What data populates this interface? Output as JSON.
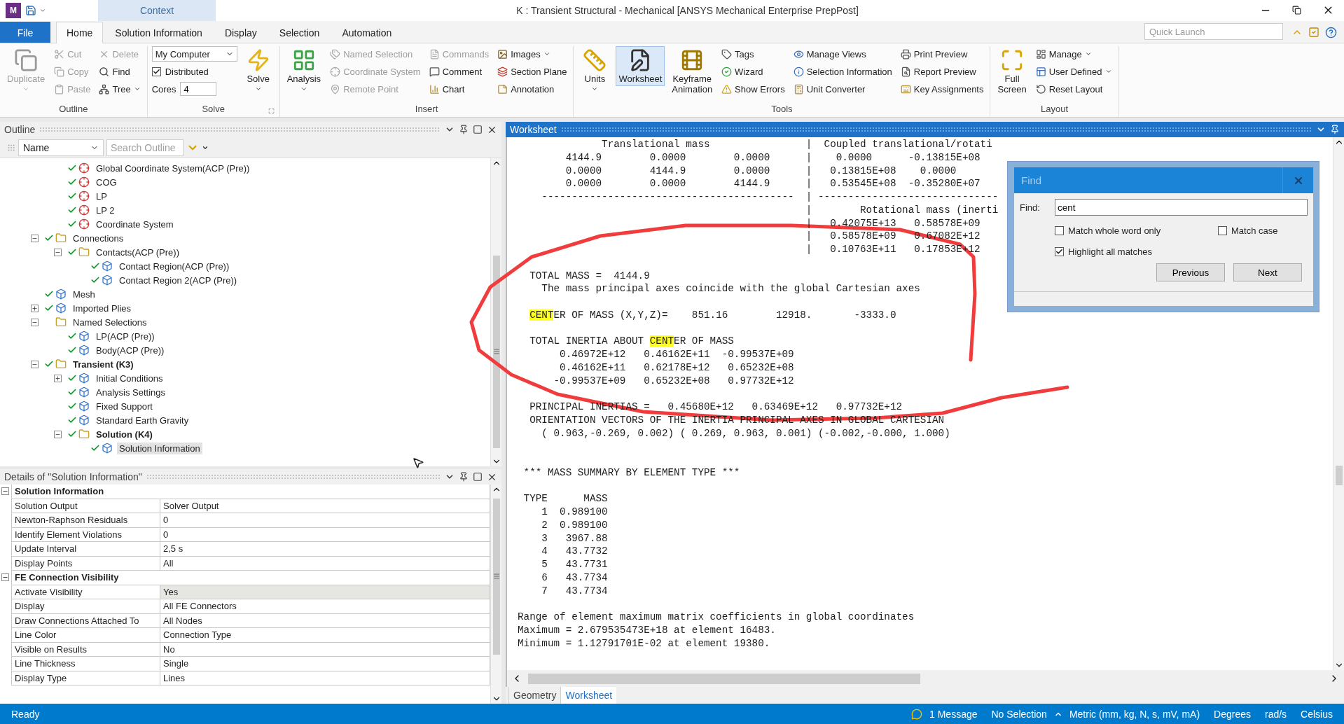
{
  "title_bar": {
    "app_badge": "M",
    "context_tab": "Context",
    "title": "K : Transient Structural - Mechanical [ANSYS Mechanical Enterprise PrepPost]"
  },
  "ribbon_tabs": [
    {
      "label": "File",
      "kind": "file",
      "selected": false
    },
    {
      "label": "Home",
      "kind": "tab",
      "selected": true
    },
    {
      "label": "Solution Information",
      "kind": "tab",
      "selected": false
    },
    {
      "label": "Display",
      "kind": "tab",
      "selected": false
    },
    {
      "label": "Selection",
      "kind": "tab",
      "selected": false
    },
    {
      "label": "Automation",
      "kind": "tab",
      "selected": false
    }
  ],
  "quick_launch": {
    "placeholder": "Quick Launch"
  },
  "ribbon_groups": [
    {
      "label": "Outline",
      "launcher": false,
      "columns": [
        [
          {
            "kind": "large",
            "label": "Duplicate",
            "disabled": true,
            "active": false,
            "menu": true
          }
        ],
        [
          {
            "kind": "small",
            "label": "Cut",
            "disabled": true,
            "menu": false
          },
          {
            "kind": "small",
            "label": "Copy",
            "disabled": true,
            "menu": false
          },
          {
            "kind": "small",
            "label": "Paste",
            "disabled": true,
            "menu": false
          }
        ],
        [
          {
            "kind": "small",
            "label": "Delete",
            "disabled": true,
            "menu": false
          },
          {
            "kind": "small",
            "label": "Find",
            "disabled": false,
            "menu": false
          },
          {
            "kind": "small",
            "label": "Tree",
            "disabled": false,
            "menu": true
          }
        ]
      ]
    },
    {
      "label": "Solve",
      "launcher": true,
      "columns": [
        [
          {
            "kind": "select",
            "value": "My Computer"
          },
          {
            "kind": "check",
            "label": "Distributed",
            "checked": true
          },
          {
            "kind": "field",
            "label": "Cores",
            "value": "4"
          }
        ],
        [
          {
            "kind": "large",
            "label": "Solve",
            "disabled": false,
            "active": false,
            "menu": true
          }
        ]
      ]
    },
    {
      "label": "Insert",
      "launcher": false,
      "columns": [
        [
          {
            "kind": "large",
            "label": "Analysis",
            "disabled": false,
            "active": false,
            "menu": true
          }
        ],
        [
          {
            "kind": "small",
            "label": "Named Selection",
            "disabled": true,
            "menu": false
          },
          {
            "kind": "small",
            "label": "Coordinate System",
            "disabled": true,
            "menu": false
          },
          {
            "kind": "small",
            "label": "Remote Point",
            "disabled": true,
            "menu": false
          }
        ],
        [
          {
            "kind": "small",
            "label": "Commands",
            "disabled": true,
            "menu": false
          },
          {
            "kind": "small",
            "label": "Comment",
            "disabled": false,
            "menu": false
          },
          {
            "kind": "small",
            "label": "Chart",
            "disabled": false,
            "menu": false
          }
        ],
        [
          {
            "kind": "small",
            "label": "Images",
            "disabled": false,
            "menu": true
          },
          {
            "kind": "small",
            "label": "Section Plane",
            "disabled": false,
            "menu": false
          },
          {
            "kind": "small",
            "label": "Annotation",
            "disabled": false,
            "menu": false
          }
        ]
      ]
    },
    {
      "label": "Tools",
      "launcher": false,
      "columns": [
        [
          {
            "kind": "large",
            "label": "Units",
            "disabled": false,
            "active": false,
            "menu": true
          }
        ],
        [
          {
            "kind": "large",
            "label": "Worksheet",
            "disabled": false,
            "active": true,
            "menu": false
          }
        ],
        [
          {
            "kind": "large",
            "label": "Keyframe Animation",
            "disabled": false,
            "active": false,
            "menu": false
          }
        ],
        [
          {
            "kind": "small",
            "label": "Tags",
            "disabled": false,
            "menu": false
          },
          {
            "kind": "small",
            "label": "Wizard",
            "disabled": false,
            "menu": false
          },
          {
            "kind": "small",
            "label": "Show Errors",
            "disabled": false,
            "menu": false
          }
        ],
        [
          {
            "kind": "small",
            "label": "Manage Views",
            "disabled": false,
            "menu": false
          },
          {
            "kind": "small",
            "label": "Selection Information",
            "disabled": false,
            "menu": false
          },
          {
            "kind": "small",
            "label": "Unit Converter",
            "disabled": false,
            "menu": false
          }
        ],
        [
          {
            "kind": "small",
            "label": "Print Preview",
            "disabled": false,
            "menu": false
          },
          {
            "kind": "small",
            "label": "Report Preview",
            "disabled": false,
            "menu": false
          },
          {
            "kind": "small",
            "label": "Key Assignments",
            "disabled": false,
            "menu": false
          }
        ]
      ]
    },
    {
      "label": "Layout",
      "launcher": false,
      "columns": [
        [
          {
            "kind": "large",
            "label": "Full Screen",
            "disabled": false,
            "active": false,
            "menu": false
          }
        ],
        [
          {
            "kind": "small",
            "label": "Manage",
            "disabled": false,
            "menu": true
          },
          {
            "kind": "small",
            "label": "User Defined",
            "disabled": false,
            "menu": true
          },
          {
            "kind": "small",
            "label": "Reset Layout",
            "disabled": false,
            "menu": false
          }
        ]
      ]
    }
  ],
  "outline": {
    "title": "Outline",
    "filter": "Name",
    "search": {
      "placeholder": "Search Outline"
    },
    "tree": {
      "continued": [
        {
          "label": "Global Coordinate System(ACP (Pre))",
          "checked": true,
          "bold": false,
          "selected": false
        },
        {
          "label": "COG",
          "checked": true,
          "bold": false,
          "selected": false
        },
        {
          "label": "LP",
          "checked": true,
          "bold": false,
          "selected": false
        },
        {
          "label": "LP 2",
          "checked": true,
          "bold": false,
          "selected": false
        },
        {
          "label": "Coordinate System",
          "checked": true,
          "bold": false,
          "selected": false
        }
      ],
      "nodes": [
        {
          "label": "Connections",
          "checked": true,
          "bold": false,
          "selected": false,
          "expanded": true,
          "children": [
            {
              "label": "Contacts(ACP (Pre))",
              "checked": true,
              "bold": false,
              "selected": false,
              "expanded": true,
              "children": [
                {
                  "label": "Contact Region(ACP (Pre))",
                  "checked": true,
                  "bold": false,
                  "selected": false
                },
                {
                  "label": "Contact Region 2(ACP (Pre))",
                  "checked": true,
                  "bold": false,
                  "selected": false
                }
              ]
            }
          ]
        },
        {
          "label": "Mesh",
          "checked": true,
          "bold": false,
          "selected": false
        },
        {
          "label": "Imported Plies",
          "checked": true,
          "bold": false,
          "selected": false,
          "expanded": false
        },
        {
          "label": "Named Selections",
          "checked": false,
          "bold": false,
          "selected": false,
          "expanded": true,
          "children": [
            {
              "label": "LP(ACP (Pre))",
              "checked": true,
              "bold": false,
              "selected": false
            },
            {
              "label": "Body(ACP (Pre))",
              "checked": true,
              "bold": false,
              "selected": false
            }
          ]
        },
        {
          "label": "Transient (K3)",
          "checked": true,
          "bold": true,
          "selected": false,
          "expanded": true,
          "children": [
            {
              "label": "Initial Conditions",
              "checked": true,
              "bold": false,
              "selected": false,
              "expanded": false
            },
            {
              "label": "Analysis Settings",
              "checked": true,
              "bold": false,
              "selected": false
            },
            {
              "label": "Fixed Support",
              "checked": true,
              "bold": false,
              "selected": false
            },
            {
              "label": "Standard Earth Gravity",
              "checked": true,
              "bold": false,
              "selected": false
            },
            {
              "label": "Solution (K4)",
              "checked": true,
              "bold": true,
              "selected": false,
              "expanded": true,
              "children": [
                {
                  "label": "Solution Information",
                  "checked": true,
                  "bold": false,
                  "selected": true
                }
              ]
            }
          ]
        }
      ]
    }
  },
  "details": {
    "title": "Details of \"Solution Information\"",
    "groups": [
      {
        "label": "Solution Information",
        "expanded": true,
        "rows": [
          {
            "name": "Solution Output",
            "value": "Solver Output",
            "selected": false
          },
          {
            "name": "Newton-Raphson Residuals",
            "value": "0",
            "selected": false
          },
          {
            "name": "Identify Element Violations",
            "value": "0",
            "selected": false
          },
          {
            "name": "Update Interval",
            "value": "2,5 s",
            "selected": false
          },
          {
            "name": "Display Points",
            "value": "All",
            "selected": false
          }
        ]
      },
      {
        "label": "FE Connection Visibility",
        "expanded": true,
        "rows": [
          {
            "name": "Activate Visibility",
            "value": "Yes",
            "selected": true
          },
          {
            "name": "Display",
            "value": "All FE Connectors",
            "selected": false
          },
          {
            "name": "Draw Connections Attached To",
            "value": "All Nodes",
            "selected": false
          },
          {
            "name": "Line Color",
            "value": "Connection Type",
            "selected": false
          },
          {
            "name": "Visible on Results",
            "value": "No",
            "selected": false
          },
          {
            "name": "Line Thickness",
            "value": "Single",
            "selected": false
          },
          {
            "name": "Display Type",
            "value": "Lines",
            "selected": false
          }
        ]
      }
    ]
  },
  "worksheet": {
    "title": "Worksheet",
    "lines": [
      {
        "kind": "text",
        "parts": [
          {
            "text": "              Translational mass                |  Coupled translational/rotati",
            "highlight": false
          }
        ]
      },
      {
        "kind": "text",
        "parts": [
          {
            "text": "        4144.9        0.0000        0.0000      |    0.0000      -0.13815E+08",
            "highlight": false
          }
        ]
      },
      {
        "kind": "text",
        "parts": [
          {
            "text": "        0.0000        4144.9        0.0000      |   0.13815E+08    0.0000",
            "highlight": false
          }
        ]
      },
      {
        "kind": "text",
        "parts": [
          {
            "text": "        0.0000        0.0000        4144.9      |   0.53545E+08  -0.35280E+07",
            "highlight": false
          }
        ]
      },
      {
        "kind": "text",
        "parts": [
          {
            "text": "    ------------------------------------------  | ------------------------------",
            "highlight": false
          }
        ]
      },
      {
        "kind": "text",
        "parts": [
          {
            "text": "                                                |        Rotational mass (inerti",
            "highlight": false
          }
        ]
      },
      {
        "kind": "text",
        "parts": [
          {
            "text": "                                                |   0.42075E+13   0.58578E+09",
            "highlight": false
          }
        ]
      },
      {
        "kind": "text",
        "parts": [
          {
            "text": "                                                |   0.58578E+09   0.67082E+12",
            "highlight": false
          }
        ]
      },
      {
        "kind": "text",
        "parts": [
          {
            "text": "                                                |   0.10763E+11   0.17853E+12",
            "highlight": false
          }
        ]
      },
      {
        "kind": "blank"
      },
      {
        "kind": "text",
        "parts": [
          {
            "text": "  TOTAL MASS =  4144.9",
            "highlight": false
          }
        ]
      },
      {
        "kind": "text",
        "parts": [
          {
            "text": "    The mass principal axes coincide with the global Cartesian axes",
            "highlight": false
          }
        ]
      },
      {
        "kind": "blank"
      },
      {
        "kind": "indented",
        "parts": [
          {
            "text": "CENT",
            "highlight": true
          },
          {
            "text": "ER OF MASS (X,Y,Z)=    851.16        12918.       -3333.0",
            "highlight": false
          }
        ]
      },
      {
        "kind": "blank"
      },
      {
        "kind": "text",
        "parts": [
          {
            "text": "  TOTAL INERTIA ABOUT ",
            "highlight": false
          },
          {
            "text": "CENT",
            "highlight": true
          },
          {
            "text": "ER OF MASS",
            "highlight": false
          }
        ]
      },
      {
        "kind": "text",
        "parts": [
          {
            "text": "       0.46972E+12   0.46162E+11  -0.99537E+09",
            "highlight": false
          }
        ]
      },
      {
        "kind": "text",
        "parts": [
          {
            "text": "       0.46162E+11   0.62178E+12   0.65232E+08",
            "highlight": false
          }
        ]
      },
      {
        "kind": "text",
        "parts": [
          {
            "text": "      -0.99537E+09   0.65232E+08   0.97732E+12",
            "highlight": false
          }
        ]
      },
      {
        "kind": "blank"
      },
      {
        "kind": "text",
        "parts": [
          {
            "text": "  PRINCIPAL INERTIAS =   0.45680E+12   0.63469E+12   0.97732E+12",
            "highlight": false
          }
        ]
      },
      {
        "kind": "text",
        "parts": [
          {
            "text": "  ORIENTATION VECTORS OF THE INERTIA PRINCIPAL AXES IN GLOBAL CARTESIAN",
            "highlight": false
          }
        ]
      },
      {
        "kind": "text",
        "parts": [
          {
            "text": "    ( 0.963,-0.269, 0.002) ( 0.269, 0.963, 0.001) (-0.002,-0.000, 1.000)",
            "highlight": false
          }
        ]
      },
      {
        "kind": "blank"
      },
      {
        "kind": "blank"
      },
      {
        "kind": "text",
        "parts": [
          {
            "text": " *** MASS SUMMARY BY ELEMENT TYPE ***",
            "highlight": false
          }
        ]
      },
      {
        "kind": "blank"
      },
      {
        "kind": "text",
        "parts": [
          {
            "text": " TYPE      MASS",
            "highlight": false
          }
        ]
      },
      {
        "kind": "text",
        "parts": [
          {
            "text": "    1  0.989100",
            "highlight": false
          }
        ]
      },
      {
        "kind": "text",
        "parts": [
          {
            "text": "    2  0.989100",
            "highlight": false
          }
        ]
      },
      {
        "kind": "text",
        "parts": [
          {
            "text": "    3   3967.88",
            "highlight": false
          }
        ]
      },
      {
        "kind": "text",
        "parts": [
          {
            "text": "    4   43.7732",
            "highlight": false
          }
        ]
      },
      {
        "kind": "text",
        "parts": [
          {
            "text": "    5   43.7731",
            "highlight": false
          }
        ]
      },
      {
        "kind": "text",
        "parts": [
          {
            "text": "    6   43.7734",
            "highlight": false
          }
        ]
      },
      {
        "kind": "text",
        "parts": [
          {
            "text": "    7   43.7734",
            "highlight": false
          }
        ]
      },
      {
        "kind": "blank"
      },
      {
        "kind": "text",
        "parts": [
          {
            "text": "Range of element maximum matrix coefficients in global coordinates",
            "highlight": false
          }
        ]
      },
      {
        "kind": "text",
        "parts": [
          {
            "text": "Maximum = 2.679535473E+18 at element 16483.",
            "highlight": false
          }
        ]
      },
      {
        "kind": "text",
        "parts": [
          {
            "text": "Minimum = 1.12791701E-02 at element 19380.",
            "highlight": false
          }
        ]
      }
    ],
    "tabs": [
      {
        "label": "Geometry",
        "selected": false
      },
      {
        "label": "Worksheet",
        "selected": true
      }
    ]
  },
  "find_dialog": {
    "title": "Find",
    "field_label": "Find:",
    "value": "cent",
    "options": [
      {
        "label": "Match whole word only",
        "checked": false
      },
      {
        "label": "Match case",
        "checked": false
      },
      {
        "label": "Highlight all matches",
        "checked": true
      }
    ],
    "buttons": [
      "Previous",
      "Next"
    ]
  },
  "status_bar": {
    "state": "Ready",
    "messages": "1 Message",
    "selection": "No Selection",
    "units": "Metric (mm, kg, N, s, mV, mA)",
    "angle": "Degrees",
    "velocity": "rad/s",
    "temperature": "Celsius"
  }
}
